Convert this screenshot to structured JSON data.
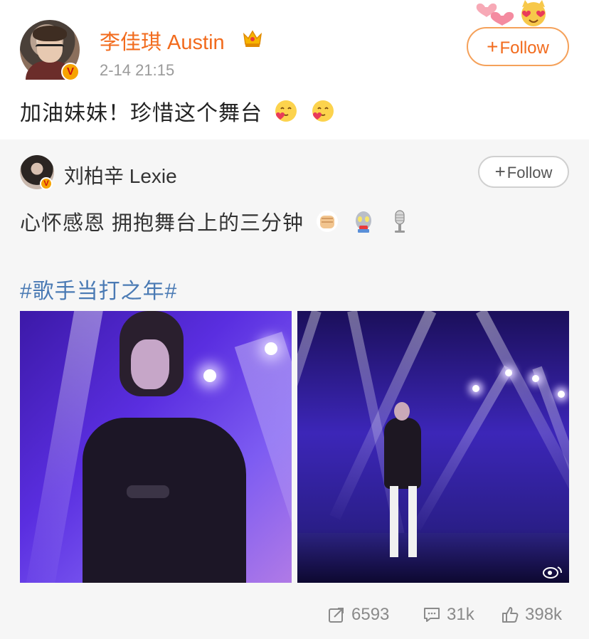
{
  "post": {
    "username": "李佳琪 Austin",
    "time": "2-14 21:15",
    "follow_label": "Follow",
    "text": "加油妹妹！珍惜这个舞台",
    "verified_badge": "V",
    "emojis": [
      "hugging-heart-emoji",
      "hugging-heart-emoji"
    ]
  },
  "repost": {
    "username": "刘柏辛 Lexie",
    "follow_label": "Follow",
    "text": "心怀感恩 拥抱舞台上的三分钟",
    "verified_badge": "V",
    "emojis": [
      "fist-emoji",
      "robot-emoji",
      "microphone-emoji"
    ],
    "hashtag": "#歌手当打之年#",
    "images": [
      "singer-closeup-photo",
      "singer-stage-photo"
    ]
  },
  "actions": {
    "reposts": "6593",
    "comments": "31k",
    "likes": "398k"
  },
  "colors": {
    "username_orange": "#f26b1d",
    "hashtag_blue": "#4a7ab4",
    "badge_gold": "#f7a300",
    "repost_bg": "#f6f6f6"
  }
}
